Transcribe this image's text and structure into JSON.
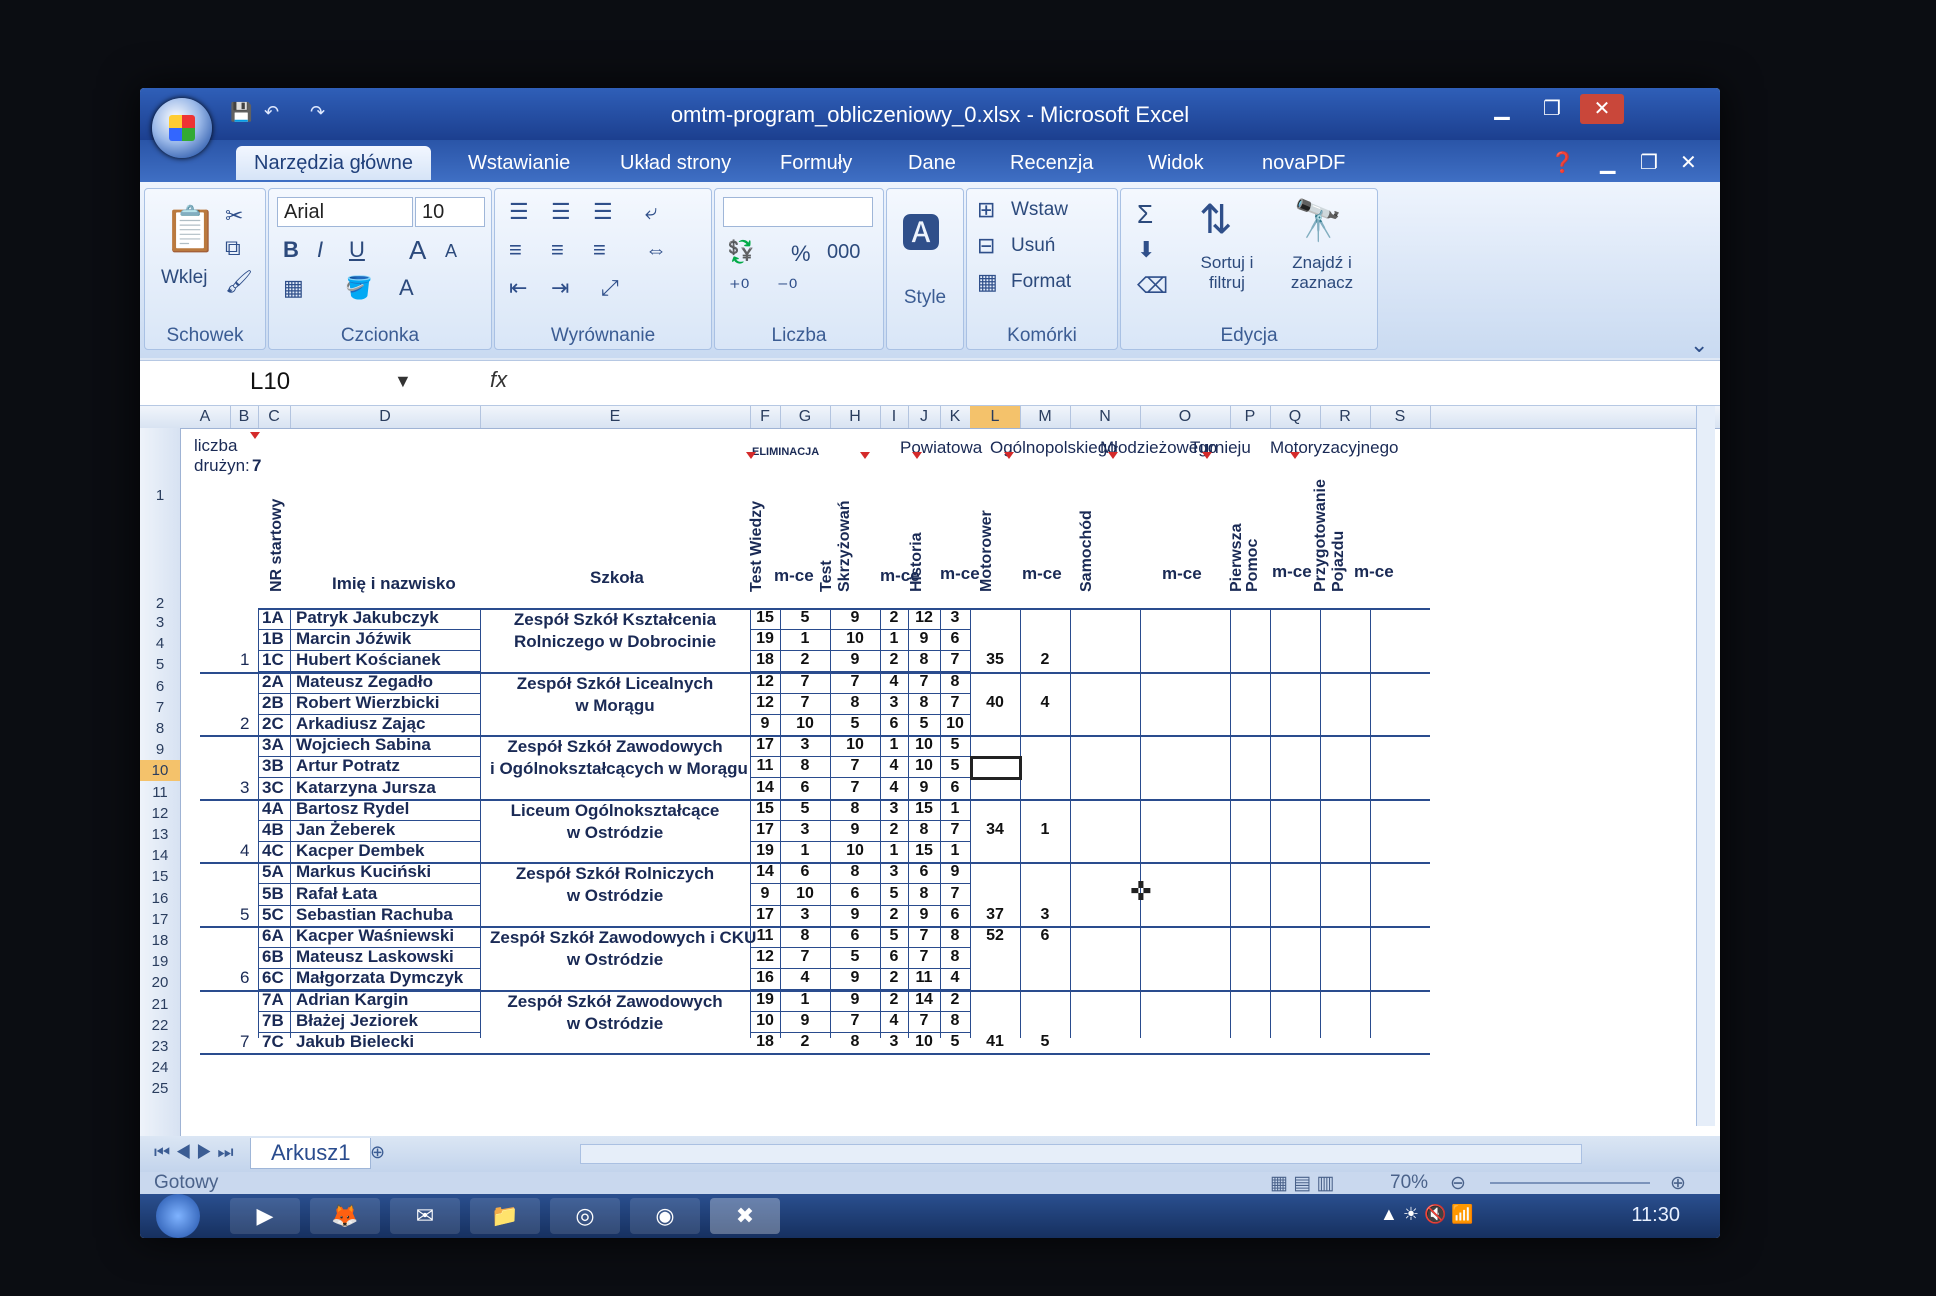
{
  "window": {
    "title": "omtm-program_obliczeniowy_0.xlsx - Microsoft Excel",
    "controls": [
      "minimize",
      "restore",
      "close"
    ]
  },
  "ribbon": {
    "tabs": [
      "Narzędzia główne",
      "Wstawianie",
      "Układ strony",
      "Formuły",
      "Dane",
      "Recenzja",
      "Widok",
      "novaPDF"
    ],
    "active_tab": "Narzędzia główne",
    "groups": {
      "schowek": {
        "label": "Schowek",
        "paste": "Wklej"
      },
      "czcionka": {
        "label": "Czcionka",
        "font": "Arial",
        "size": "10",
        "bold": "B",
        "italic": "I",
        "underline": "U",
        "grow": "A",
        "shrink": "A",
        "fontcolor": "A"
      },
      "wyrownanie": {
        "label": "Wyrównanie"
      },
      "liczba": {
        "label": "Liczba",
        "percent": "%",
        "thousands": "000",
        "inc_dec": ",0\n,00",
        "dec_dec": ",00\n,0"
      },
      "style": {
        "label": "Style"
      },
      "komorki": {
        "label": "Komórki",
        "insert": "Wstaw",
        "delete": "Usuń",
        "format": "Format"
      },
      "edycja": {
        "label": "Edycja",
        "sum": "Σ",
        "sort": "Sortuj i filtruj",
        "find": "Znajdź i zaznacz"
      }
    }
  },
  "formula_bar": {
    "name_box": "L10",
    "fx": "fx",
    "value": ""
  },
  "columns": [
    "A",
    "B",
    "C",
    "D",
    "E",
    "F",
    "G",
    "H",
    "I",
    "J",
    "K",
    "L",
    "M",
    "N",
    "O",
    "P",
    "Q",
    "R",
    "S"
  ],
  "selected_column": "L",
  "rows": [
    "1",
    "2",
    "3",
    "4",
    "5",
    "6",
    "7",
    "8",
    "9",
    "10",
    "11",
    "12",
    "13",
    "14",
    "15",
    "16",
    "17",
    "18",
    "19",
    "20",
    "21",
    "22",
    "23",
    "24",
    "25"
  ],
  "selected_row": "10",
  "sheet": {
    "teams_label": "liczba",
    "teams_label2": "drużyn:",
    "teams_count": "7",
    "eliminacja": "ELIMINACJA",
    "banner": [
      "Powiatowa",
      "Ogólnopolskiego",
      "Młodzieżowego",
      "Turnieju",
      "Motoryzacyjnego"
    ],
    "header_start_no": "NR startowy",
    "header_name": "Imię i nazwisko",
    "header_school": "Szkoła",
    "header_test": "Test Wiedzy",
    "header_mce": "m-ce",
    "header_test2a": "Test",
    "header_test2b": "Skrzyżowań",
    "header_hist": "Historia",
    "header_motor": "Motorower",
    "header_car": "Samochód",
    "header_first_aid_a": "Pierwsza",
    "header_first_aid_b": "Pomoc",
    "header_prep_a": "Przygotowanie",
    "header_prep_b": "Pojazdu",
    "teams": [
      {
        "no": "1",
        "school": [
          "Zespół Szkół Kształcenia",
          "Rolniczego w Dobrocinie"
        ]
      },
      {
        "no": "2",
        "school": [
          "Zespół Szkół Licealnych",
          "w Morągu"
        ]
      },
      {
        "no": "3",
        "school": [
          "Zespół Szkół Zawodowych",
          "i Ogólnokształcących w Morągu"
        ]
      },
      {
        "no": "4",
        "school": [
          "Liceum Ogólnokształcące",
          "w Ostródzie"
        ]
      },
      {
        "no": "5",
        "school": [
          "Zespół Szkół Rolniczych",
          "w Ostródzie"
        ]
      },
      {
        "no": "6",
        "school": [
          "Zespół Szkół Zawodowych i CKU",
          "w Ostródzie"
        ]
      },
      {
        "no": "7",
        "school": [
          "Zespół Szkół Zawodowych",
          "w Ostródzie"
        ]
      }
    ],
    "players": [
      {
        "id": "1A",
        "name": "Patryk Jakubczyk",
        "f": "15",
        "g": "5",
        "h": "9",
        "i": "2",
        "j": "12",
        "k": "3",
        "l": "",
        "m": ""
      },
      {
        "id": "1B",
        "name": "Marcin Jóźwik",
        "f": "19",
        "g": "1",
        "h": "10",
        "i": "1",
        "j": "9",
        "k": "6",
        "l": "",
        "m": ""
      },
      {
        "id": "1C",
        "name": "Hubert Kościanek",
        "f": "18",
        "g": "2",
        "h": "9",
        "i": "2",
        "j": "8",
        "k": "7",
        "l": "35",
        "m": "2"
      },
      {
        "id": "2A",
        "name": "Mateusz Zegadło",
        "f": "12",
        "g": "7",
        "h": "7",
        "i": "4",
        "j": "7",
        "k": "8",
        "l": "",
        "m": ""
      },
      {
        "id": "2B",
        "name": "Robert Wierzbicki",
        "f": "12",
        "g": "7",
        "h": "8",
        "i": "3",
        "j": "8",
        "k": "7",
        "l": "40",
        "m": "4"
      },
      {
        "id": "2C",
        "name": "Arkadiusz Zając",
        "f": "9",
        "g": "10",
        "h": "5",
        "i": "6",
        "j": "5",
        "k": "10",
        "l": "",
        "m": ""
      },
      {
        "id": "3A",
        "name": "Wojciech Sabina",
        "f": "17",
        "g": "3",
        "h": "10",
        "i": "1",
        "j": "10",
        "k": "5",
        "l": "",
        "m": ""
      },
      {
        "id": "3B",
        "name": "Artur Potratz",
        "f": "11",
        "g": "8",
        "h": "7",
        "i": "4",
        "j": "10",
        "k": "5",
        "l": "",
        "m": ""
      },
      {
        "id": "3C",
        "name": "Katarzyna Jursza",
        "f": "14",
        "g": "6",
        "h": "7",
        "i": "4",
        "j": "9",
        "k": "6",
        "l": "",
        "m": ""
      },
      {
        "id": "4A",
        "name": "Bartosz Rydel",
        "f": "15",
        "g": "5",
        "h": "8",
        "i": "3",
        "j": "15",
        "k": "1",
        "l": "",
        "m": ""
      },
      {
        "id": "4B",
        "name": "Jan Żeberek",
        "f": "17",
        "g": "3",
        "h": "9",
        "i": "2",
        "j": "8",
        "k": "7",
        "l": "34",
        "m": "1"
      },
      {
        "id": "4C",
        "name": "Kacper Dembek",
        "f": "19",
        "g": "1",
        "h": "10",
        "i": "1",
        "j": "15",
        "k": "1",
        "l": "",
        "m": ""
      },
      {
        "id": "5A",
        "name": "Markus Kuciński",
        "f": "14",
        "g": "6",
        "h": "8",
        "i": "3",
        "j": "6",
        "k": "9",
        "l": "",
        "m": ""
      },
      {
        "id": "5B",
        "name": "Rafał Łata",
        "f": "9",
        "g": "10",
        "h": "6",
        "i": "5",
        "j": "8",
        "k": "7",
        "l": "",
        "m": ""
      },
      {
        "id": "5C",
        "name": "Sebastian Rachuba",
        "f": "17",
        "g": "3",
        "h": "9",
        "i": "2",
        "j": "9",
        "k": "6",
        "l": "37",
        "m": "3"
      },
      {
        "id": "6A",
        "name": "Kacper Waśniewski",
        "f": "11",
        "g": "8",
        "h": "6",
        "i": "5",
        "j": "7",
        "k": "8",
        "l": "52",
        "m": "6"
      },
      {
        "id": "6B",
        "name": "Mateusz Laskowski",
        "f": "12",
        "g": "7",
        "h": "5",
        "i": "6",
        "j": "7",
        "k": "8",
        "l": "",
        "m": ""
      },
      {
        "id": "6C",
        "name": "Małgorzata Dymczyk",
        "f": "16",
        "g": "4",
        "h": "9",
        "i": "2",
        "j": "11",
        "k": "4",
        "l": "",
        "m": ""
      },
      {
        "id": "7A",
        "name": "Adrian Kargin",
        "f": "19",
        "g": "1",
        "h": "9",
        "i": "2",
        "j": "14",
        "k": "2",
        "l": "",
        "m": ""
      },
      {
        "id": "7B",
        "name": "Błażej Jeziorek",
        "f": "10",
        "g": "9",
        "h": "7",
        "i": "4",
        "j": "7",
        "k": "8",
        "l": "",
        "m": ""
      },
      {
        "id": "7C",
        "name": "Jakub Bielecki",
        "f": "18",
        "g": "2",
        "h": "8",
        "i": "3",
        "j": "10",
        "k": "5",
        "l": "41",
        "m": "5"
      }
    ]
  },
  "sheet_tabs": {
    "active": "Arkusz1"
  },
  "status": {
    "ready": "Gotowy",
    "zoom": "70%"
  },
  "taskbar": {
    "clock": "11:30"
  },
  "colors": {
    "accent": "#2a55a8",
    "grid_lines": "#2a4c8e",
    "selection": "#f4c26b"
  }
}
